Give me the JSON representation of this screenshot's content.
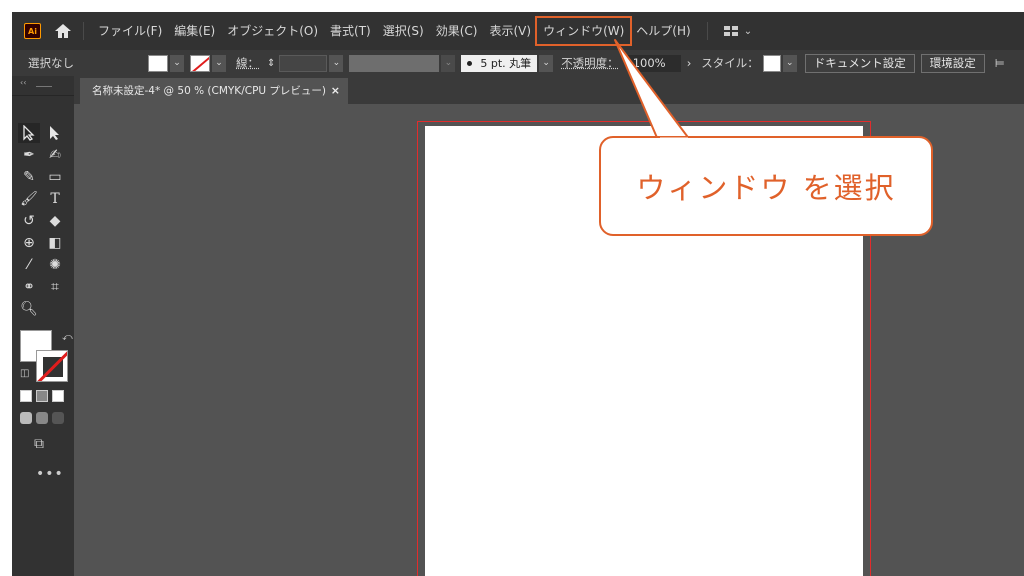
{
  "app": {
    "logo_text": "Ai",
    "accent": "#e0612a"
  },
  "menubar": {
    "items": [
      "ファイル(F)",
      "編集(E)",
      "オブジェクト(O)",
      "書式(T)",
      "選択(S)",
      "効果(C)",
      "表示(V)",
      "ウィンドウ(W)",
      "ヘルプ(H)"
    ],
    "highlighted": "ウィンドウ(W)"
  },
  "controlbar": {
    "selection_label": "選択なし",
    "stroke_label": "線：",
    "brush_label": "5 pt. 丸筆",
    "opacity_label": "不透明度：",
    "opacity_value": "100%",
    "style_label": "スタイル：",
    "document_setup_button": "ドキュメント設定",
    "preferences_button": "環境設定"
  },
  "document_tab": {
    "title": "名称未設定-4* @ 50 % (CMYK/CPU プレビュー)",
    "close": "×"
  },
  "callout": {
    "text": "ウィンドウ を選択"
  },
  "icons": {
    "home": "home-icon",
    "workspace": "workspace-switcher-icon",
    "more_tools": "•••"
  }
}
